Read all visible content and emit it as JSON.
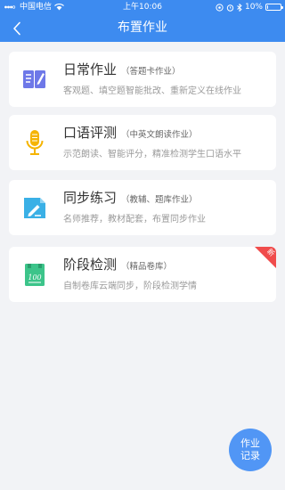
{
  "status_bar": {
    "carrier": "中国电信",
    "time": "上午10:06",
    "battery": "10%",
    "battery_level": 0.1
  },
  "nav": {
    "title": "布置作业",
    "back_icon": "chevron-left-icon"
  },
  "cards": [
    {
      "title": "日常作业",
      "tag": "（答题卡作业）",
      "desc": "客观题、填空题智能批改、重新定义在线作业",
      "icon": "notebook-pen-icon",
      "color": "#6e78e8"
    },
    {
      "title": "口语评测",
      "tag": "（中英文朗读作业）",
      "desc": "示范朗读、智能评分，精准检测学生口语水平",
      "icon": "microphone-icon",
      "color": "#f5b400"
    },
    {
      "title": "同步练习",
      "tag": "（教辅、题库作业）",
      "desc": "名师推荐，教材配套，布置同步作业",
      "icon": "document-edit-icon",
      "color": "#3ab0e6"
    },
    {
      "title": "阶段检测",
      "tag": "（精品卷库）",
      "desc": "自制卷库云端同步，阶段检测学情",
      "icon": "exam-paper-icon",
      "color": "#3cc48a",
      "badge": "新"
    }
  ],
  "badge_color": "#f04c4c",
  "header_color": "#3d8bf0",
  "fab": {
    "line1": "作业",
    "line2": "记录",
    "color": "#5196f5"
  }
}
